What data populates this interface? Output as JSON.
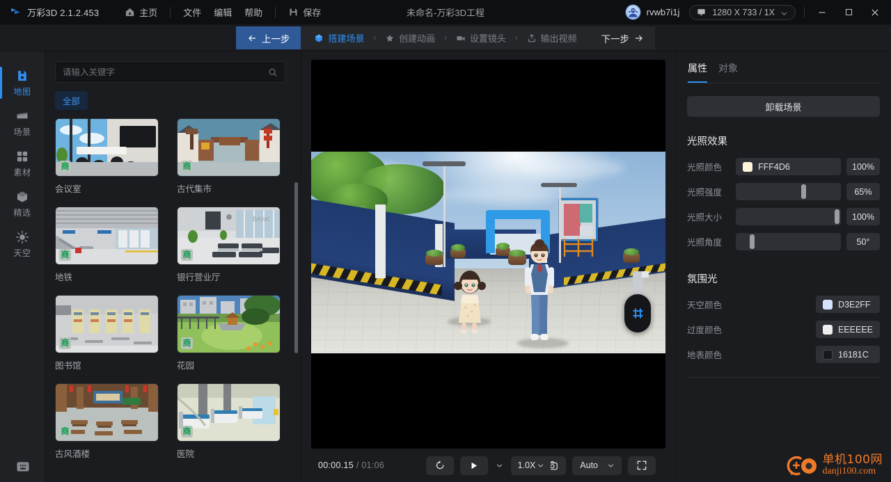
{
  "titlebar": {
    "app_name": "万彩3D 2.1.2.453",
    "menu": [
      {
        "label": "主页",
        "icon": "home-icon"
      },
      {
        "label": "文件",
        "icon": ""
      },
      {
        "label": "编辑",
        "icon": ""
      },
      {
        "label": "帮助",
        "icon": ""
      },
      {
        "label": "保存",
        "icon": "save-icon"
      }
    ],
    "document_title": "未命名-万彩3D工程",
    "username": "rvwb7i1j",
    "resolution": "1280 X 733 / 1X",
    "window_buttons": {
      "minimize": "—",
      "maximize": "▢",
      "close": "✕"
    }
  },
  "stepbar": {
    "prev_label": "上一步",
    "next_label": "下一步",
    "steps": [
      {
        "label": "搭建场景",
        "icon": "cube-icon",
        "active": true
      },
      {
        "label": "创建动画",
        "icon": "star-icon",
        "active": false
      },
      {
        "label": "设置镜头",
        "icon": "camera-icon",
        "active": false
      },
      {
        "label": "输出视频",
        "icon": "export-icon",
        "active": false
      }
    ],
    "separator": "›"
  },
  "rail": {
    "items": [
      {
        "label": "地图",
        "icon": "map-icon",
        "active": true
      },
      {
        "label": "场景",
        "icon": "scene-icon",
        "active": false
      },
      {
        "label": "素材",
        "icon": "grid-icon",
        "active": false
      },
      {
        "label": "精选",
        "icon": "cube-icon",
        "active": false
      },
      {
        "label": "天空",
        "icon": "sun-icon",
        "active": false
      }
    ],
    "feedback_icon": "feedback-icon"
  },
  "assets": {
    "search_placeholder": "请输入关键字",
    "search_value": "",
    "search_icon": "search-icon",
    "filters": [
      {
        "label": "全部",
        "active": true
      }
    ],
    "badge_text": "商",
    "cards": [
      {
        "label": "会议室",
        "badge": "商"
      },
      {
        "label": "古代集市",
        "badge": "商"
      },
      {
        "label": "地铁",
        "badge": "商"
      },
      {
        "label": "银行营业厅",
        "badge": "商"
      },
      {
        "label": "图书馆",
        "badge": "商"
      },
      {
        "label": "花园",
        "badge": "商"
      },
      {
        "label": "古风酒楼",
        "badge": "商"
      },
      {
        "label": "医院",
        "badge": "商"
      }
    ]
  },
  "player": {
    "current_time": "00:00.15",
    "separator": "/",
    "total_time": "01:06",
    "replay_icon": "replay-icon",
    "play_icon": "play-icon",
    "speed_label": "1.0X",
    "camera_icon": "camera-snapshot-icon",
    "quality_label": "Auto",
    "fullscreen_icon": "fullscreen-icon"
  },
  "viewport": {
    "gizmo_icon": "grid-gizmo-icon"
  },
  "properties": {
    "tabs": [
      {
        "label": "属性",
        "active": true
      },
      {
        "label": "对象",
        "active": false
      }
    ],
    "unload_button": "卸载场景",
    "lighting": {
      "title": "光照效果",
      "rows": [
        {
          "label": "光照颜色",
          "type": "color",
          "color": "#FFF4D6",
          "hex": "FFF4D6",
          "value": "100%"
        },
        {
          "label": "光照强度",
          "type": "slider",
          "value": "65%",
          "percent": 65
        },
        {
          "label": "光照大小",
          "type": "slider",
          "value": "100%",
          "percent": 100
        },
        {
          "label": "光照角度",
          "type": "slider",
          "value": "50°",
          "percent": 14
        }
      ]
    },
    "ambient": {
      "title": "氛围光",
      "rows": [
        {
          "label": "天空颜色",
          "color": "#D3E2FF",
          "hex": "D3E2FF"
        },
        {
          "label": "过度颜色",
          "color": "#EEEEEE",
          "hex": "EEEEEE"
        },
        {
          "label": "地表颜色",
          "color": "#16181C",
          "hex": "16181C"
        }
      ]
    }
  },
  "watermark": {
    "line1": "单机100网",
    "line2": "danji100.com",
    "color": "#F07A28"
  },
  "theme": {
    "accent": "#2F8FF0",
    "titlebar_bg": "#0E0F11",
    "panel_bg": "#1B1C1F",
    "rail_bg": "#202125",
    "badge_green": "#119A4F"
  }
}
